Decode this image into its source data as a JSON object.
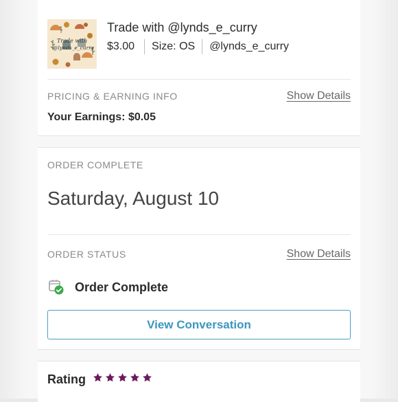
{
  "item": {
    "title": "Trade with @lynds_e_curry",
    "price": "$3.00",
    "size": "Size: OS",
    "seller": "@lynds_e_curry",
    "thumbnail_text_line1": "Trade with",
    "thumbnail_text_line2": "@lynds_e_curry"
  },
  "pricing": {
    "label": "PRICING & EARNING INFO",
    "show_details": "Show Details",
    "earnings": "Your Earnings: $0.05"
  },
  "order": {
    "complete_label": "ORDER COMPLETE",
    "date": "Saturday, August 10",
    "status_label": "ORDER STATUS",
    "show_details": "Show Details",
    "status_text": "Order Complete",
    "status_icon": "package-check-icon",
    "view_conversation": "View Conversation"
  },
  "rating": {
    "label": "Rating",
    "stars": 5,
    "max_stars": 5,
    "star_color": "#6b1a5c"
  },
  "colors": {
    "accent_blue": "#3b96c0",
    "check_green": "#3aaa4a",
    "star_purple": "#6b1a5c"
  }
}
